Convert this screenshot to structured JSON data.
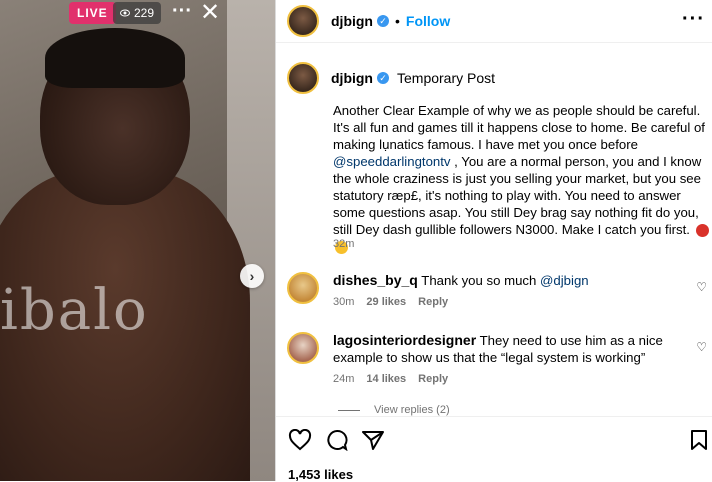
{
  "media": {
    "live_label": "LIVE",
    "viewer_count": "229",
    "watermark": "ibalo"
  },
  "post": {
    "username": "djbign",
    "follow_label": "Follow",
    "separator": "•"
  },
  "caption": {
    "username": "djbign",
    "tag": "Temporary Post",
    "text_before": "Another Clear Example of why we as people should be careful. It's all fun and games till it happens close to home. Be careful of making lụnatics famous. I have met you once before ",
    "mention": "@speeddarlingtontv",
    "text_after": " , You are a normal person, you and I know the whole craziness is just you selling your market, but you see statutory ræp£, it's nothing to play with. You need to answer some questions asap. You still Dey brag say nothing fit do you, still Dey dash gullible followers N3000. Make I catch you first.",
    "time": "32m"
  },
  "comments": [
    {
      "username": "dishes_by_q",
      "text": "Thank you so much",
      "mention": "@djbign",
      "time": "30m",
      "likes": "29 likes",
      "reply_label": "Reply"
    },
    {
      "username": "lagosinteriordesigner",
      "text": "They need to use him as a nice example to show us that the “legal system is working”",
      "time": "24m",
      "likes": "14 likes",
      "reply_label": "Reply"
    }
  ],
  "view_replies": "View replies (2)",
  "likes_count": "1,453 likes",
  "icons": [
    "eye-icon",
    "more-icon",
    "close-icon",
    "chevron-right-icon",
    "verified-icon",
    "heart-icon",
    "comment-icon",
    "share-icon",
    "bookmark-icon"
  ]
}
